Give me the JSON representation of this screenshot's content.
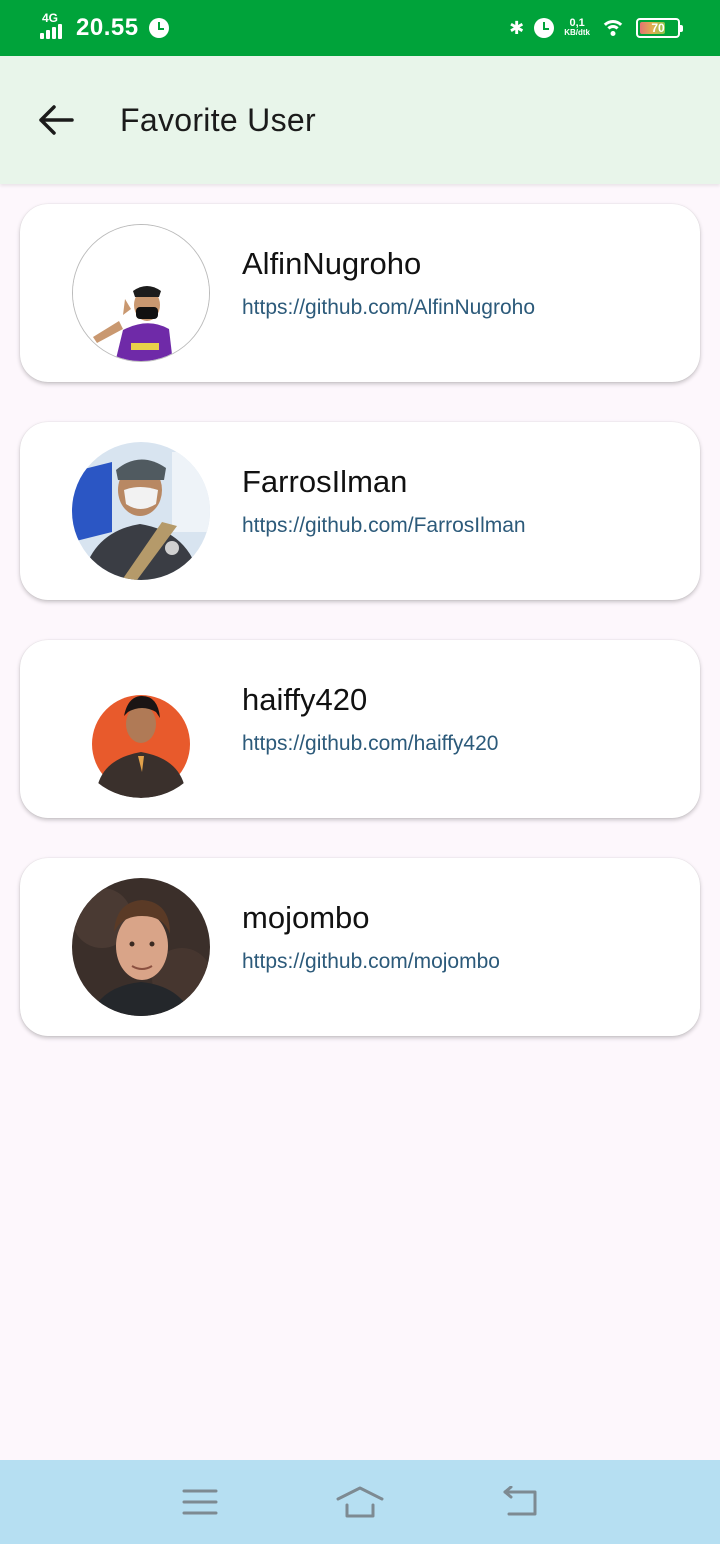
{
  "status_bar": {
    "network": "4G",
    "time": "20.55",
    "speed_value": "0,1",
    "speed_unit": "KB/dtk",
    "battery_percent": "70",
    "battery_level": 0.7,
    "icons": [
      "signal-icon",
      "alarm-icon",
      "bluetooth-icon",
      "alarm-icon",
      "wifi-icon",
      "battery-icon"
    ]
  },
  "app_bar": {
    "title": "Favorite User",
    "back_icon": "arrow-back-icon",
    "background": "#e8f5ea"
  },
  "users": [
    {
      "username": "AlfinNugroho",
      "url": "https://github.com/AlfinNugroho"
    },
    {
      "username": "FarrosIlman",
      "url": "https://github.com/FarrosIlman"
    },
    {
      "username": "haiffy420",
      "url": "https://github.com/haiffy420"
    },
    {
      "username": "mojombo",
      "url": "https://github.com/mojombo"
    }
  ],
  "nav_bar": {
    "icons": [
      "menu-icon",
      "home-icon",
      "back-icon"
    ],
    "background": "#b6dff2"
  },
  "colors": {
    "status_bar": "#00a33a",
    "link": "#2c5a7a",
    "page_background": "#fdf7fc"
  }
}
